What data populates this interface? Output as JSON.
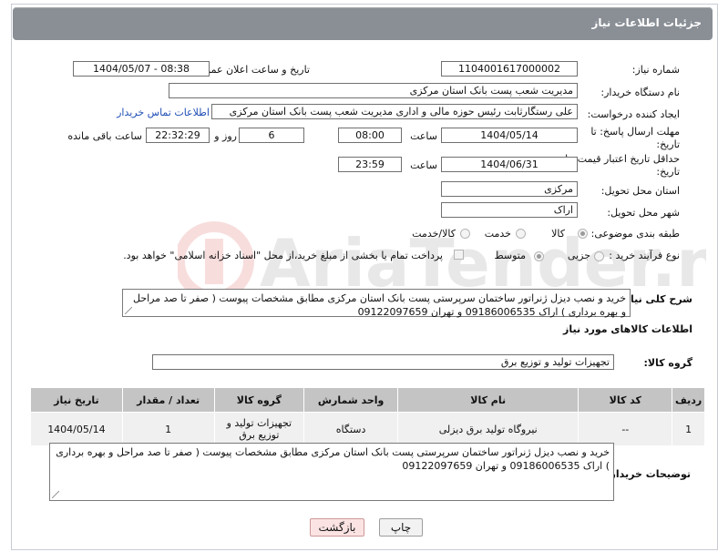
{
  "header": {
    "title": "جزئیات اطلاعات نیاز"
  },
  "fields": {
    "need_number_label": "شماره نیاز:",
    "need_number": "1104001617000002",
    "announce_label": "تاریخ و ساعت اعلان عمومی:",
    "announce_value": "1404/05/07 - 08:38",
    "buyer_org_label": "نام دستگاه خریدار:",
    "buyer_org": "مدیریت شعب پست بانک استان مرکزی",
    "requester_label": "ایجاد کننده درخواست:",
    "requester": "علی رستگارثابت رئیس حوزه مالی و اداری مدیریت شعب پست بانک استان مرکزی",
    "contact_link": "اطلاعات تماس خریدار",
    "reply_deadline_label": "مهلت ارسال پاسخ: تا تاریخ:",
    "reply_date": "1404/05/14",
    "time_label": "ساعت",
    "reply_time": "08:00",
    "days_value": "6",
    "days_label": "روز و",
    "remaining_time": "22:32:29",
    "remaining_label": "ساعت باقی مانده",
    "validity_label": "حداقل تاریخ اعتبار قیمت: تا تاریخ:",
    "validity_date": "1404/06/31",
    "validity_time": "23:59",
    "province_label": "استان محل تحویل:",
    "province": "مرکزی",
    "city_label": "شهر محل تحویل:",
    "city": "اراک",
    "category_label": "طبقه بندی موضوعی:",
    "category_options": [
      "کالا",
      "خدمت",
      "کالا/خدمت"
    ],
    "process_label": "نوع فرآیند خرید :",
    "process_options": [
      "جزیی",
      "متوسط"
    ],
    "payment_note": "پرداخت تمام یا بخشی از مبلغ خرید،از محل \"اسناد خزانه اسلامی\" خواهد بود.",
    "description_label": "شرح کلی نیاز:",
    "description": "خرید و نصب دیزل ژنراتور ساختمان سرپرستی پست بانک استان مرکزی مطابق مشخصات پیوست ( صفر تا صد مراحل و بهره برداری ) اراک 09186006535 و تهران 09122097659"
  },
  "goods": {
    "section_title": "اطلاعات کالاهای مورد نیاز",
    "group_label": "گروه کالا:",
    "group_value": "تجهیزات تولید و توزیع برق",
    "columns": [
      "ردیف",
      "کد کالا",
      "نام کالا",
      "واحد شمارش",
      "گروه کالا",
      "تعداد / مقدار",
      "تاریخ نیاز"
    ],
    "rows": [
      {
        "row": "1",
        "code": "--",
        "name": "نیروگاه تولید برق دیزلی",
        "unit": "دستگاه",
        "group": "تجهیزات تولید و توزیع برق",
        "qty": "1",
        "date": "1404/05/14"
      }
    ]
  },
  "buyer_notes": {
    "label": "توضیحات خریدار:",
    "text": "خرید و نصب دیزل ژنراتور ساختمان سرپرستی پست بانک استان مرکزی مطابق مشخصات پیوست ( صفر تا صد مراحل و بهره برداری ) اراک 09186006535 و تهران 09122097659"
  },
  "buttons": {
    "print": "چاپ",
    "back": "بازگشت"
  },
  "watermark": {
    "text": "AriaTender.neT"
  },
  "colors": {
    "header_bg": "#8a8f96",
    "link": "#1f4fb5",
    "back_bg": "#fbe3e3",
    "print_bg": "#f2f2f2"
  }
}
